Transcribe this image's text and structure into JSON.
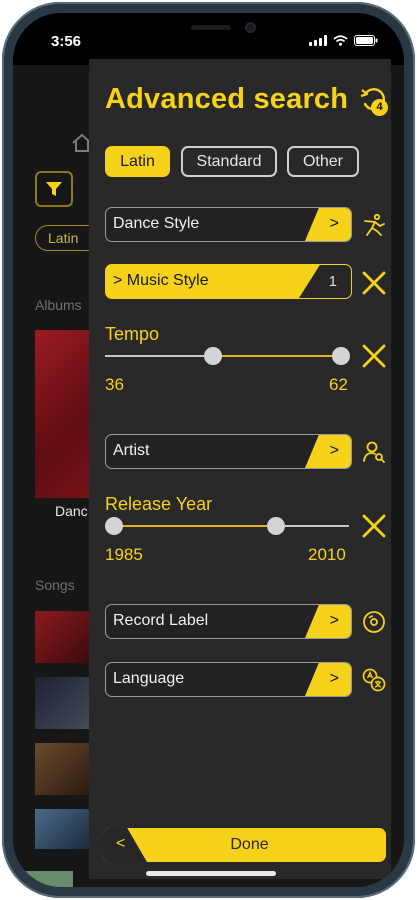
{
  "status_bar": {
    "time": "3:56"
  },
  "background": {
    "chip": "Latin",
    "albums_label": "Albums",
    "album_title": "Danc",
    "songs_label": "Songs"
  },
  "panel": {
    "title": "Advanced search",
    "active_filter_count": "4",
    "tabs": [
      {
        "label": "Latin",
        "active": true
      },
      {
        "label": "Standard",
        "active": false
      },
      {
        "label": "Other",
        "active": false
      }
    ],
    "dance_style": {
      "label": "Dance Style",
      "arrow": ">"
    },
    "music_style": {
      "label": "> Music Style",
      "count": "1"
    },
    "tempo": {
      "label": "Tempo",
      "min": "36",
      "max": "62"
    },
    "artist": {
      "label": "Artist",
      "arrow": ">"
    },
    "release_year": {
      "label": "Release Year",
      "min": "1985",
      "max": "2010"
    },
    "record_label": {
      "label": "Record Label",
      "arrow": ">"
    },
    "language": {
      "label": "Language",
      "arrow": ">"
    },
    "footer": {
      "back": "<",
      "done": "Done"
    }
  },
  "colors": {
    "accent": "#f7d21a",
    "panel": "#282828",
    "background": "#161616"
  },
  "icons": [
    "funnel-icon",
    "home-icon",
    "reset-filters-icon",
    "dancer-icon",
    "close-icon",
    "person-search-icon",
    "disc-icon",
    "translate-icon"
  ]
}
